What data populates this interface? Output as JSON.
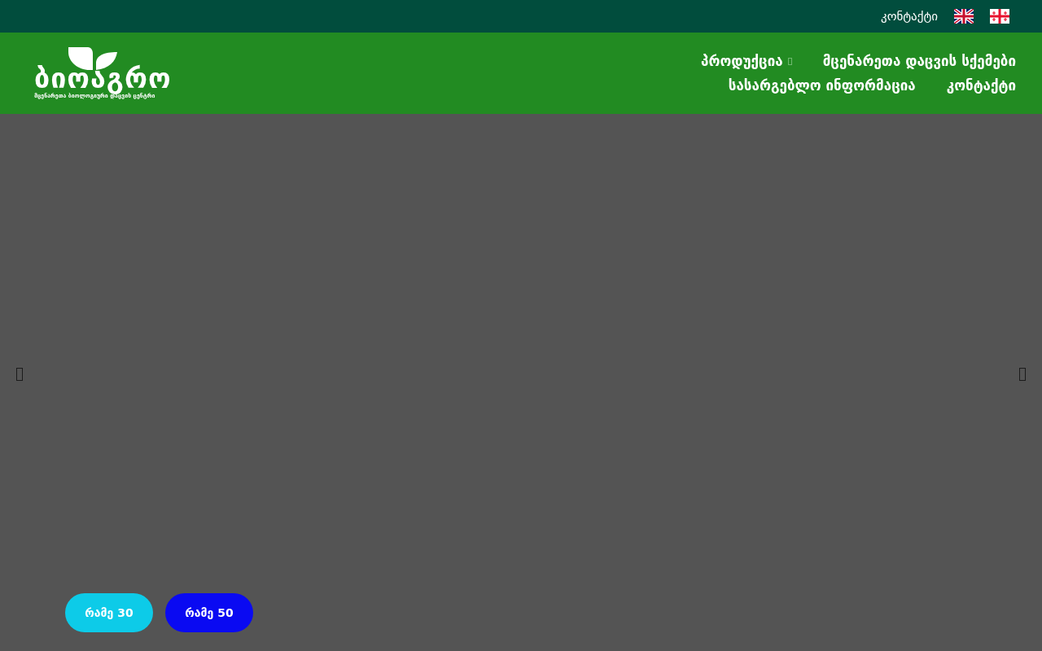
{
  "top_bar": {
    "contact_link": "კონტაქტი",
    "languages": [
      {
        "kind": "uk"
      },
      {
        "kind": "georgia"
      }
    ]
  },
  "header": {
    "logo": {
      "title": "ბიოაგრო",
      "subtitle": "მცენარეთა ბიოლოგიური დაცვის ცენტრი"
    },
    "nav": [
      {
        "label": "პროდუქცია",
        "dropdown": true
      },
      {
        "label": "მცენარეთა დაცვის სქემები",
        "dropdown": false
      },
      {
        "label": "სასარგებლო ინფორმაცია",
        "dropdown": false
      },
      {
        "label": "კონტაქტი",
        "dropdown": false
      }
    ]
  },
  "slider": {
    "buttons": [
      {
        "label": "რამე 30",
        "color": "#0dcbe8"
      },
      {
        "label": "რამე 50",
        "color": "#0a0af2"
      }
    ]
  }
}
